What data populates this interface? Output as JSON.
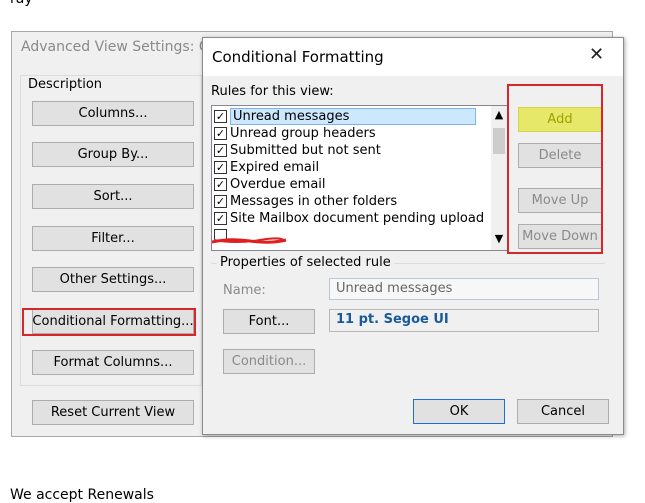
{
  "top_text": "ray",
  "bottom_text": "We accept Renewals",
  "advanced_view": {
    "title": "Advanced View Settings: Co",
    "description_label": "Description",
    "buttons": {
      "columns": "Columns...",
      "group_by": "Group By...",
      "sort": "Sort...",
      "filter": "Filter...",
      "other_settings": "Other Settings...",
      "conditional_formatting": "Conditional Formatting...",
      "format_columns": "Format Columns...",
      "reset_view": "Reset Current View"
    }
  },
  "conditional_formatting": {
    "title": "Conditional Formatting",
    "close_glyph": "✕",
    "rules_label": "Rules for this view:",
    "rules": [
      {
        "label": "Unread messages",
        "checked": true,
        "selected": true
      },
      {
        "label": "Unread group headers",
        "checked": true
      },
      {
        "label": "Submitted but not sent",
        "checked": true
      },
      {
        "label": "Expired email",
        "checked": true
      },
      {
        "label": "Overdue email",
        "checked": true
      },
      {
        "label": "Messages in other folders",
        "checked": true
      },
      {
        "label": "Site Mailbox document pending upload",
        "checked": true
      }
    ],
    "side_buttons": {
      "add": "Add",
      "delete": "Delete",
      "move_up": "Move Up",
      "move_down": "Move Down"
    },
    "properties_label": "Properties of selected rule",
    "name_label": "Name:",
    "name_value": "Unread messages",
    "font_button": "Font...",
    "font_value": "11 pt. Segoe UI",
    "condition_button": "Condition...",
    "ok": "OK",
    "cancel": "Cancel"
  },
  "colors": {
    "highlight_red": "#d9262b",
    "highlight_yellow": "#e6e86a",
    "selected_rule_bg": "#cce8ff"
  }
}
